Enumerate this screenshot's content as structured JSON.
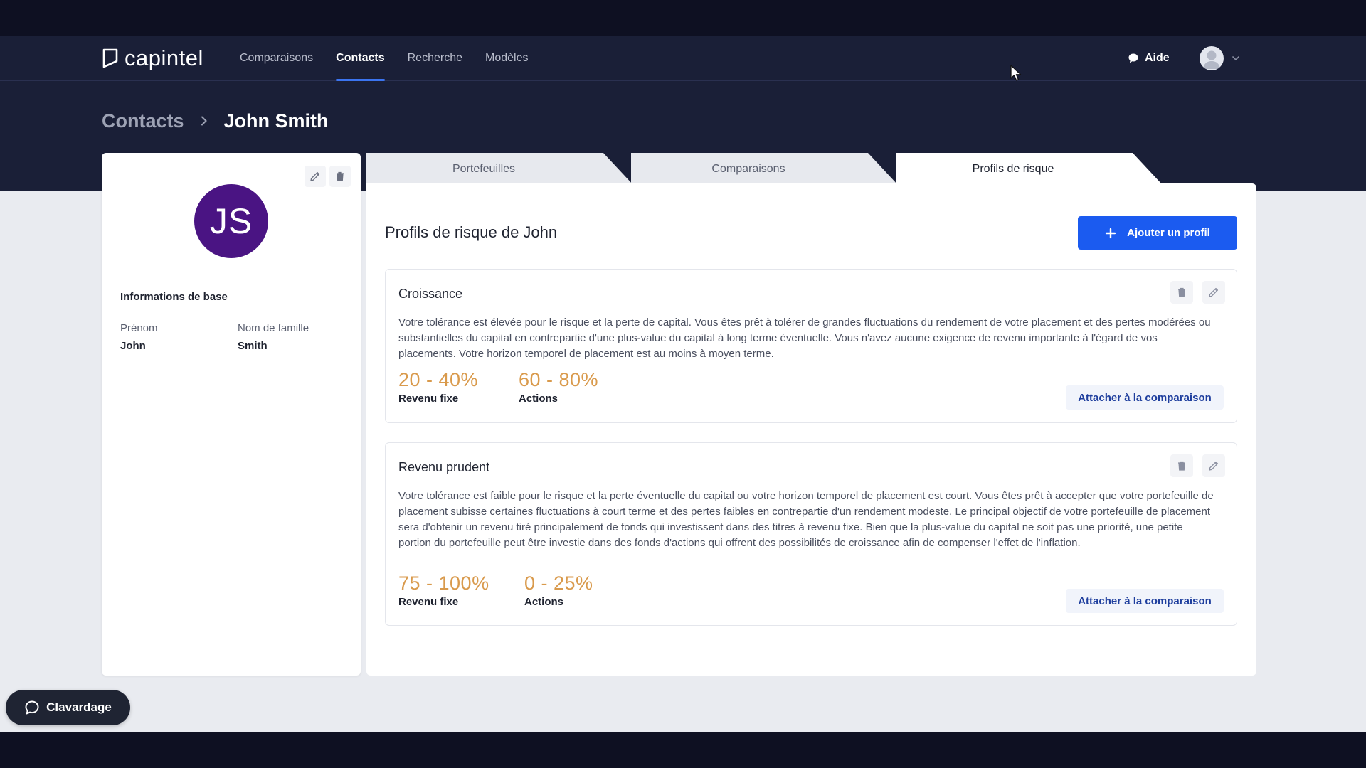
{
  "app": {
    "logo_text": "capintel"
  },
  "nav": {
    "links": [
      "Comparaisons",
      "Contacts",
      "Recherche",
      "Modèles"
    ],
    "help_label": "Aide"
  },
  "breadcrumb": {
    "parent": "Contacts",
    "current": "John Smith"
  },
  "contact": {
    "initials": "JS",
    "info_title": "Informations de base",
    "first_name_label": "Prénom",
    "first_name": "John",
    "last_name_label": "Nom de famille",
    "last_name": "Smith"
  },
  "tabs": [
    "Portefeuilles",
    "Comparaisons",
    "Profils de risque"
  ],
  "panel": {
    "title": "Profils de risque de John",
    "add_button": "Ajouter un profil"
  },
  "profiles": [
    {
      "name": "Croissance",
      "description": "Votre tolérance est élevée pour le risque et la perte de capital. Vous êtes prêt à tolérer de grandes fluctuations du rendement de votre placement et des pertes modérées ou substantielles du capital en contrepartie d'une plus-value du capital à long terme éventuelle. Vous n'avez aucune exigence de revenu importante à l'égard de vos placements. Votre horizon temporel de placement est au moins à moyen terme.",
      "fixed_income_range": "20 - 40%",
      "fixed_income_label": "Revenu fixe",
      "equity_range": "60 - 80%",
      "equity_label": "Actions",
      "attach_label": "Attacher à la comparaison"
    },
    {
      "name": "Revenu prudent",
      "description": "Votre tolérance est faible pour le risque et la perte éventuelle du capital ou votre horizon temporel de placement est court. Vous êtes prêt à accepter que votre portefeuille de placement subisse certaines fluctuations à court terme et des pertes faibles en contrepartie d'un rendement modeste. Le principal objectif de votre portefeuille de placement sera d'obtenir un revenu tiré principalement de fonds qui investissent dans des titres à revenu fixe. Bien que la plus-value du capital ne soit pas une priorité, une petite portion du portefeuille peut être investie dans des fonds d'actions qui offrent des possibilités de croissance afin de compenser l'effet de l'inflation.",
      "fixed_income_range": "75 - 100%",
      "fixed_income_label": "Revenu fixe",
      "equity_range": "0 - 25%",
      "equity_label": "Actions",
      "attach_label": "Attacher à la comparaison"
    }
  ],
  "chat": {
    "label": "Clavardage"
  },
  "colors": {
    "header_bg": "#1a1f37",
    "accent_blue": "#1b5bf0",
    "avatar_purple": "#4a1483",
    "range_orange": "#d99a4c"
  },
  "icons": {
    "logo": "capintel-logo-icon",
    "help": "chat-bubble-icon",
    "user": "user-avatar-icon",
    "edit": "pencil-icon",
    "delete": "trash-icon",
    "add": "plus-icon",
    "chat": "speech-bubble-icon"
  }
}
